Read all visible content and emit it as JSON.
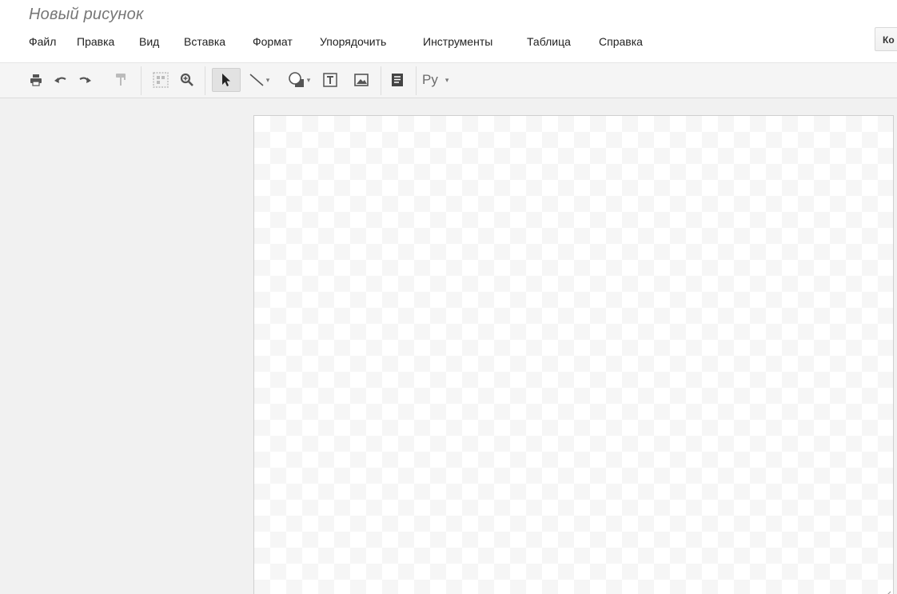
{
  "app": {
    "document_title": "Новый рисунок"
  },
  "menu": {
    "items": [
      {
        "id": "file",
        "label": "Файл"
      },
      {
        "id": "edit",
        "label": "Правка"
      },
      {
        "id": "view",
        "label": "Вид"
      },
      {
        "id": "insert",
        "label": "Вставка"
      },
      {
        "id": "format",
        "label": "Формат"
      },
      {
        "id": "arrange",
        "label": "Упорядочить"
      },
      {
        "id": "tools",
        "label": "Инструменты"
      },
      {
        "id": "table",
        "label": "Таблица"
      },
      {
        "id": "help",
        "label": "Справка"
      }
    ]
  },
  "header": {
    "share_button_label": "Ко"
  },
  "toolbar": {
    "font_label": "Ру",
    "buttons": [
      {
        "id": "print",
        "icon": "print-icon"
      },
      {
        "id": "undo",
        "icon": "undo-icon"
      },
      {
        "id": "redo",
        "icon": "redo-icon"
      },
      {
        "id": "paint-format",
        "icon": "paint-format-icon"
      },
      {
        "id": "fit",
        "icon": "zoom-fit-icon"
      },
      {
        "id": "zoom",
        "icon": "zoom-in-icon"
      },
      {
        "id": "select",
        "icon": "select-arrow-icon",
        "active": true
      },
      {
        "id": "line",
        "icon": "line-icon"
      },
      {
        "id": "shape",
        "icon": "shape-icon"
      },
      {
        "id": "textbox",
        "icon": "textbox-icon"
      },
      {
        "id": "image",
        "icon": "image-icon"
      },
      {
        "id": "comment",
        "icon": "comment-icon"
      }
    ]
  },
  "colors": {
    "toolbar_bg": "#f5f5f5",
    "workspace_bg": "#f1f1f1",
    "icon": "#555555",
    "title": "#777777"
  }
}
